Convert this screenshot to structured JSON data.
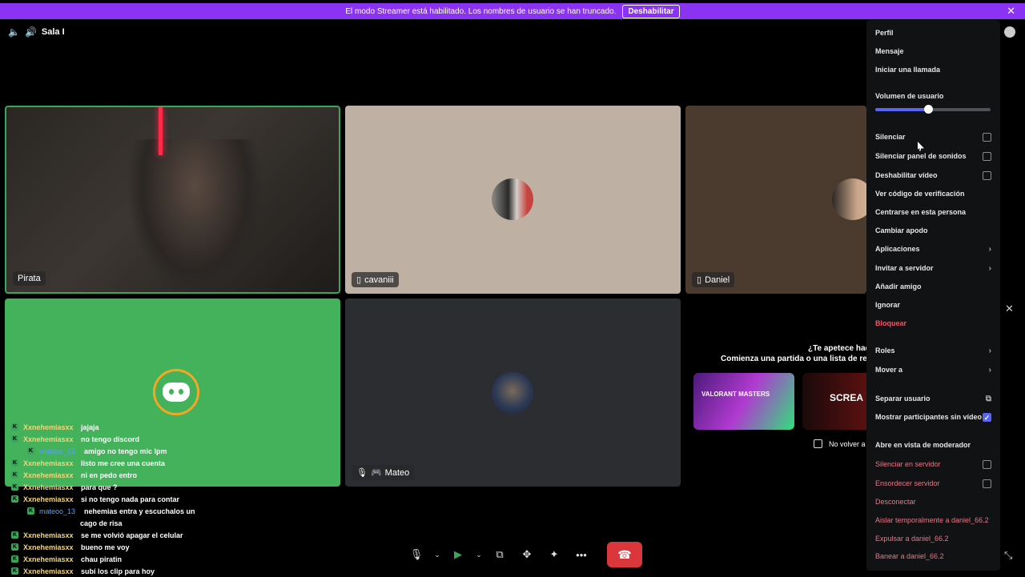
{
  "banner": {
    "text": "El modo Streamer está habilitado. Los nombres de usuario se han truncado.",
    "button": "Deshabilitar",
    "close": "✕"
  },
  "channel": {
    "name": "Sala I"
  },
  "tiles": [
    {
      "name": "Pirata"
    },
    {
      "name": "cavaniii"
    },
    {
      "name": "Daniel"
    },
    {
      "name": "Mateo"
    }
  ],
  "activity": {
    "title": "¿Te apetece hac",
    "subtitle": "Comienza una partida o una lista de rep",
    "card1": "VALORANT MASTERS",
    "card2": "SCREA",
    "checkbox_label": "No volver a"
  },
  "menu": {
    "profile": "Perfil",
    "message": "Mensaje",
    "call": "Iniciar una llamada",
    "volume_label": "Volumen de usuario",
    "volume_percent": 46,
    "mute": "Silenciar",
    "mute_soundboard": "Silenciar panel de sonidos",
    "disable_video": "Deshabilitar vídeo",
    "verify_code": "Ver código de verificación",
    "focus": "Centrarse en esta persona",
    "nickname": "Cambiar apodo",
    "apps": "Aplicaciones",
    "invite": "Invitar a servidor",
    "add_friend": "Añadir amigo",
    "ignore": "Ignorar",
    "block": "Bloquear",
    "roles": "Roles",
    "move": "Mover a",
    "popout": "Separar usuario",
    "show_no_video": "Mostrar participantes sin vídeo",
    "mod_view": "Abre en vista de moderador",
    "server_mute": "Silenciar en servidor",
    "server_deafen": "Ensordecer servidor",
    "disconnect": "Desconectar",
    "timeout": "Aislar temporalmente a daniel_66.2",
    "kick": "Expulsar a daniel_66.2",
    "ban": "Banear a daniel_66.2"
  },
  "chat": [
    {
      "user": "Xxnehemiasxx",
      "text": "jajaja",
      "style": "y"
    },
    {
      "user": "Xxnehemiasxx",
      "text": "no tengo discord",
      "style": "y"
    },
    {
      "user": "mateoo_13",
      "text": "amigo no tengo mic lpm",
      "style": "b"
    },
    {
      "user": "Xxnehemiasxx",
      "text": "listo me cree una cuenta",
      "style": "y"
    },
    {
      "user": "Xxnehemiasxx",
      "text": "ni en pedo entro",
      "style": "y"
    },
    {
      "user": "Xxnehemiasxx",
      "text": "para que ?",
      "style": "y"
    },
    {
      "user": "Xxnehemiasxx",
      "text": "si no tengo nada para contar",
      "style": "y"
    },
    {
      "user": "mateoo_13",
      "text": "nehemias entra y escuchalos un",
      "style": "b"
    },
    {
      "user": "",
      "text": "cago de risa",
      "style": "c"
    },
    {
      "user": "Xxnehemiasxx",
      "text": "se me volvió apagar el celular",
      "style": "y"
    },
    {
      "user": "Xxnehemiasxx",
      "text": "bueno me voy",
      "style": "y"
    },
    {
      "user": "Xxnehemiasxx",
      "text": "chau piratin",
      "style": "y"
    },
    {
      "user": "Xxnehemiasxx",
      "text": "subí los clip para hoy",
      "style": "y"
    }
  ],
  "colors": {
    "accent": "#5865f2",
    "banner": "#8a33f2",
    "green_tile": "#43b25a",
    "hangup": "#da373c"
  }
}
